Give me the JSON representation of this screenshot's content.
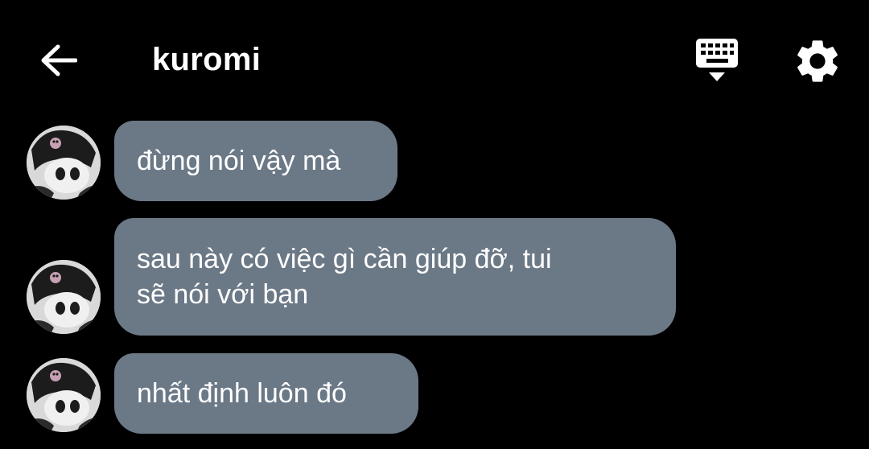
{
  "header": {
    "title": "kuromi",
    "back_icon": "arrow-left-icon",
    "keyboard_icon": "keyboard-hide-icon",
    "settings_icon": "gear-icon"
  },
  "messages": [
    {
      "lines": [
        "đừng nói vậy mà"
      ]
    },
    {
      "lines": [
        "sau này có việc gì cần giúp đỡ, tui",
        "sẽ nói với bạn"
      ]
    },
    {
      "lines": [
        "nhất định luôn đó"
      ]
    }
  ],
  "colors": {
    "background": "#000000",
    "bubble": "#6b7886",
    "text": "#ffffff"
  }
}
